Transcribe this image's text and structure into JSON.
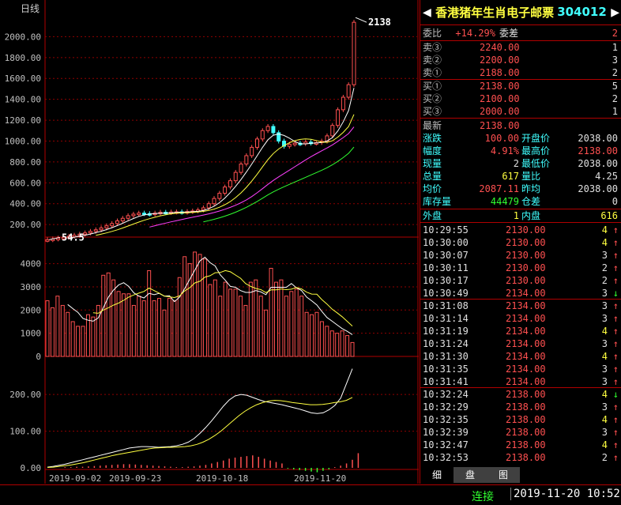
{
  "chart": {
    "period_label": "日线",
    "price_axis": [
      "2000.00",
      "1800.00",
      "1600.00",
      "1400.00",
      "1200.00",
      "1000.00",
      "800.00",
      "600.00",
      "400.00",
      "200.00"
    ],
    "vol_axis": [
      "4000",
      "3000",
      "2000",
      "1000",
      "0"
    ],
    "ind_axis": [
      "200.00",
      "100.00",
      "0.00"
    ],
    "dates": [
      "2019-09-02",
      "2019-09-23",
      "2019-10-18",
      "2019-11-20"
    ],
    "high_label": "2138",
    "low_label": "54.5"
  },
  "chart_data": {
    "type": "candlestick",
    "price_range": [
      80,
      2200
    ],
    "volume_range": [
      0,
      4600
    ],
    "indicator_range": [
      0,
      280
    ],
    "closes": [
      55,
      62,
      70,
      78,
      88,
      98,
      108,
      120,
      135,
      150,
      168,
      188,
      210,
      235,
      260,
      285,
      300,
      310,
      305,
      300,
      310,
      318,
      315,
      320,
      322,
      318,
      325,
      330,
      340,
      360,
      400,
      450,
      500,
      560,
      620,
      700,
      780,
      860,
      940,
      1020,
      1100,
      1140,
      1080,
      1000,
      950,
      970,
      980,
      975,
      990,
      980,
      985,
      1000,
      1050,
      1150,
      1300,
      1420,
      1540,
      2138
    ],
    "volumes": [
      2400,
      2100,
      2600,
      2200,
      1900,
      1500,
      1300,
      1300,
      1800,
      1700,
      2200,
      3500,
      3600,
      3300,
      2800,
      2700,
      2700,
      2200,
      2600,
      2400,
      3700,
      2400,
      2500,
      2000,
      2500,
      2400,
      3400,
      4300,
      4000,
      4500,
      4400,
      4200,
      3100,
      3300,
      2600,
      3200,
      2900,
      2900,
      2600,
      2200,
      3200,
      3300,
      2600,
      2000,
      3800,
      3200,
      3300,
      2600,
      2800,
      2900,
      2600,
      1900,
      1800,
      1900,
      1500,
      1300,
      1100,
      1000,
      1100,
      900,
      600
    ],
    "dif_line": [
      2,
      4,
      7,
      10,
      14,
      18,
      22,
      26,
      30,
      34,
      38,
      42,
      46,
      50,
      54,
      56,
      58,
      58,
      57,
      56,
      57,
      58,
      60,
      64,
      70,
      80,
      94,
      110,
      128,
      148,
      168,
      185,
      196,
      200,
      198,
      192,
      186,
      181,
      178,
      175,
      172,
      168,
      164,
      160,
      155,
      150,
      148,
      150,
      158,
      170,
      190,
      230,
      270
    ],
    "dea_line": [
      1,
      2,
      4,
      6,
      8,
      11,
      14,
      18,
      22,
      26,
      30,
      34,
      37,
      40,
      43,
      46,
      49,
      52,
      54,
      55,
      56,
      56,
      57,
      58,
      60,
      64,
      70,
      78,
      88,
      100,
      114,
      128,
      142,
      154,
      164,
      172,
      178,
      182,
      184,
      183,
      181,
      178,
      176,
      174,
      172,
      172,
      173,
      175,
      178,
      180,
      184,
      192
    ],
    "macd_bars": [
      0,
      0,
      0,
      2,
      2,
      3,
      3,
      4,
      5,
      6,
      7,
      8,
      9,
      10,
      10,
      9,
      8,
      7,
      6,
      5,
      4,
      3,
      2,
      2,
      3,
      4,
      6,
      8,
      12,
      16,
      20,
      25,
      28,
      30,
      32,
      34,
      30,
      25,
      20,
      16,
      12,
      -2,
      -4,
      -6,
      -8,
      -10,
      -12,
      -8,
      -4,
      2,
      6,
      12,
      22,
      40
    ]
  },
  "panel": {
    "name": "香港猪年生肖电子邮票",
    "code": "304012",
    "weibi_label": "委比",
    "weibi": "+14.29%",
    "weicha_label": "委差",
    "weicha": "2",
    "asks": [
      {
        "label": "卖③",
        "price": "2240.00",
        "vol": "1"
      },
      {
        "label": "卖②",
        "price": "2200.00",
        "vol": "3"
      },
      {
        "label": "卖①",
        "price": "2188.00",
        "vol": "2"
      }
    ],
    "bids": [
      {
        "label": "买①",
        "price": "2138.00",
        "vol": "5"
      },
      {
        "label": "买②",
        "price": "2100.00",
        "vol": "2"
      },
      {
        "label": "买③",
        "price": "2000.00",
        "vol": "1"
      }
    ],
    "last_label": "最新",
    "last": "2138.00",
    "chg_label": "涨跌",
    "chg": "100.00",
    "open_label": "开盘价",
    "open": "2038.00",
    "pct_label": "幅度",
    "pct": "4.91%",
    "high_label": "最高价",
    "high": "2138.00",
    "cur_label": "现量",
    "cur": "2",
    "low_label": "最低价",
    "low": "2038.00",
    "tot_label": "总量",
    "tot": "617",
    "lb_label": "量比",
    "lb": "4.25",
    "avg_label": "均价",
    "avg": "2087.11",
    "pavg_label": "昨均",
    "pavg": "2038.00",
    "stock_label": "库存量",
    "stock": "44479",
    "pos_label": "仓差",
    "pos": "0",
    "outer_label": "外盘",
    "outer": "1",
    "inner_label": "内盘",
    "inner": "616",
    "ticks": [
      {
        "t": "10:29:55",
        "p": "2130.00",
        "v": "4",
        "a": "↑",
        "pc": "red",
        "vc": "yel",
        "ac": "red"
      },
      {
        "t": "10:30:00",
        "p": "2130.00",
        "v": "4",
        "a": "↑",
        "pc": "red",
        "vc": "yel",
        "ac": "red"
      },
      {
        "t": "10:30:07",
        "p": "2130.00",
        "v": "3",
        "a": "↑",
        "pc": "red",
        "vc": "wht",
        "ac": "red"
      },
      {
        "t": "10:30:11",
        "p": "2130.00",
        "v": "2",
        "a": "↑",
        "pc": "red",
        "vc": "wht",
        "ac": "red"
      },
      {
        "t": "10:30:17",
        "p": "2130.00",
        "v": "2",
        "a": "↑",
        "pc": "red",
        "vc": "wht",
        "ac": "red"
      },
      {
        "t": "10:30:49",
        "p": "2134.00",
        "v": "3",
        "a": "↓",
        "pc": "red",
        "vc": "wht",
        "ac": "grn"
      },
      {
        "t": "10:31:08",
        "p": "2134.00",
        "v": "3",
        "a": "↑",
        "pc": "red",
        "vc": "wht",
        "ac": "red"
      },
      {
        "t": "10:31:14",
        "p": "2134.00",
        "v": "3",
        "a": "↑",
        "pc": "red",
        "vc": "wht",
        "ac": "red"
      },
      {
        "t": "10:31:19",
        "p": "2134.00",
        "v": "4",
        "a": "↑",
        "pc": "red",
        "vc": "yel",
        "ac": "red"
      },
      {
        "t": "10:31:24",
        "p": "2134.00",
        "v": "3",
        "a": "↑",
        "pc": "red",
        "vc": "wht",
        "ac": "red"
      },
      {
        "t": "10:31:30",
        "p": "2134.00",
        "v": "4",
        "a": "↑",
        "pc": "red",
        "vc": "yel",
        "ac": "red"
      },
      {
        "t": "10:31:35",
        "p": "2134.00",
        "v": "3",
        "a": "↑",
        "pc": "red",
        "vc": "wht",
        "ac": "red"
      },
      {
        "t": "10:31:41",
        "p": "2134.00",
        "v": "3",
        "a": "↑",
        "pc": "red",
        "vc": "wht",
        "ac": "red"
      },
      {
        "t": "10:32:24",
        "p": "2138.00",
        "v": "4",
        "a": "↓",
        "pc": "red",
        "vc": "yel",
        "ac": "grn"
      },
      {
        "t": "10:32:29",
        "p": "2138.00",
        "v": "3",
        "a": "↑",
        "pc": "red",
        "vc": "wht",
        "ac": "red"
      },
      {
        "t": "10:32:35",
        "p": "2138.00",
        "v": "4",
        "a": "↑",
        "pc": "red",
        "vc": "yel",
        "ac": "red"
      },
      {
        "t": "10:32:39",
        "p": "2138.00",
        "v": "3",
        "a": "↑",
        "pc": "red",
        "vc": "wht",
        "ac": "red"
      },
      {
        "t": "10:32:47",
        "p": "2138.00",
        "v": "4",
        "a": "↑",
        "pc": "red",
        "vc": "yel",
        "ac": "red"
      },
      {
        "t": "10:32:53",
        "p": "2138.00",
        "v": "2",
        "a": "↑",
        "pc": "red",
        "vc": "wht",
        "ac": "red"
      }
    ],
    "tabs": [
      "细",
      "盘",
      "图"
    ]
  },
  "status": {
    "conn": "连接",
    "datetime": "2019-11-20 10:52"
  }
}
